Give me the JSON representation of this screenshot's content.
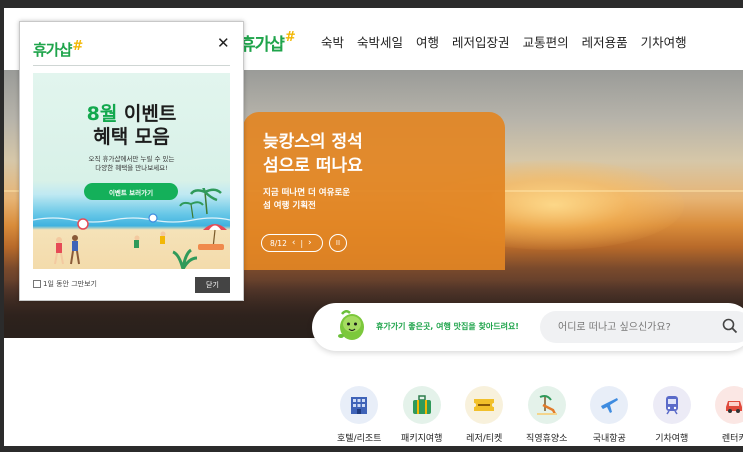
{
  "header": {
    "logo_text": "휴가샵",
    "logo_mark": "#",
    "nav": [
      "숙박",
      "숙박세일",
      "여행",
      "레저입장권",
      "교통편의",
      "레저용품",
      "기차여행"
    ]
  },
  "hero": {
    "title_line1": "늦캉스의 정석",
    "title_line2": "섬으로 떠나요",
    "desc_line1": "지금 떠나면 더 여유로운",
    "desc_line2": "섬 여행 기획전",
    "pager": "8/12",
    "prev_glyph": "‹",
    "next_glyph": "›",
    "separator": "|",
    "pause_glyph": "II"
  },
  "search": {
    "tagline": "휴가가기 좋은곳, 여행 맛집을 찾아드려요!",
    "placeholder": "어디로 떠나고 싶으신가요?"
  },
  "categories": [
    {
      "label": "호텔/리조트",
      "icon": "hotel-icon",
      "bg": "#e8eef8"
    },
    {
      "label": "패키지여행",
      "icon": "suitcase-icon",
      "bg": "#e4f2ea"
    },
    {
      "label": "레저/티켓",
      "icon": "ticket-icon",
      "bg": "#f8f1dc"
    },
    {
      "label": "직영휴양소",
      "icon": "beach-chair-icon",
      "bg": "#e4f2ea"
    },
    {
      "label": "국내항공",
      "icon": "airplane-icon",
      "bg": "#e8eef8"
    },
    {
      "label": "기차여행",
      "icon": "train-icon",
      "bg": "#ecebf6"
    },
    {
      "label": "렌터카",
      "icon": "car-icon",
      "bg": "#fbe7e4"
    }
  ],
  "popup": {
    "logo_text": "휴가샵",
    "logo_mark": "#",
    "close_glyph": "✕",
    "banner_title_hl": "8월",
    "banner_title_rest": " 이벤트",
    "banner_title_line2": "혜택 모음",
    "banner_desc_line1": "오직 휴가샵에서만 누릴 수 있는",
    "banner_desc_line2": "다양한 혜택을 만나보세요!",
    "cta": "이벤트 보러가기",
    "hide_today_label": "1일 동안 그만보기",
    "close_label": "닫기"
  },
  "colors": {
    "brand_green": "#1fa44b",
    "hash_yellow": "#f2b705",
    "promo_orange": "#e28523"
  }
}
